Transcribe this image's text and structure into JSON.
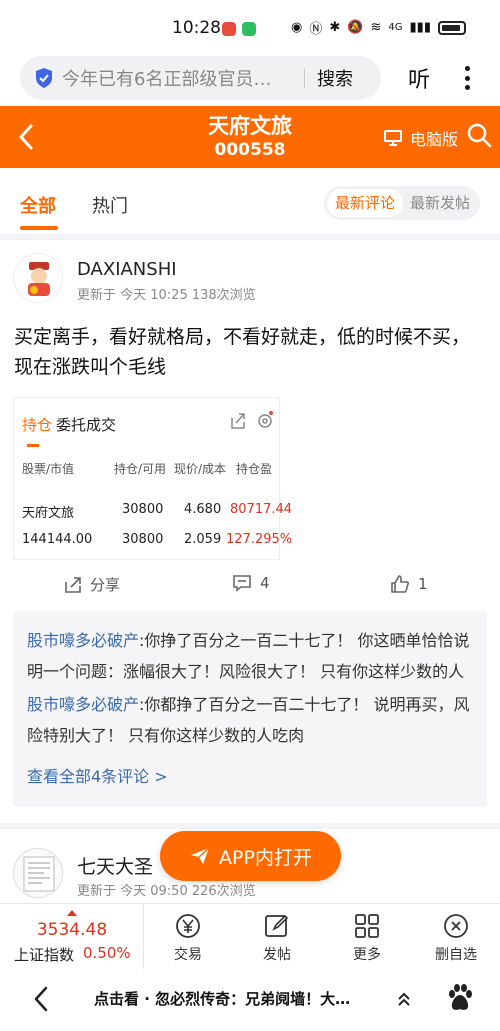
{
  "status_bar": {
    "time": "10:28",
    "network": "4G",
    "battery_level": 0.75
  },
  "browser": {
    "url_text": "今年已有6名正部级官员…",
    "search_label": "搜索",
    "listen_label": "听"
  },
  "header": {
    "stock_name": "天府文旅",
    "stock_code": "000558",
    "pc_view_label": "电脑版"
  },
  "tabs": {
    "all": "全部",
    "hot": "热门"
  },
  "sort": {
    "latest_comment": "最新评论",
    "latest_post": "最新发帖"
  },
  "post": {
    "author": "DAXIANSHI",
    "meta": "更新于 今天 10:25   138次浏览",
    "text": "买定离手，看好就格局，不看好就走，低的时候不买，现在涨跌叫个毛线",
    "embed": {
      "tab_position": "持仓",
      "tab_orders": "委托成交",
      "headers": [
        "股票/市值",
        "持仓/可用",
        "现价/成本",
        "持仓盈"
      ],
      "row1": {
        "name": "天府文旅",
        "holding": "30800",
        "price": "4.680",
        "pnl": "80717.44"
      },
      "row2": {
        "name": "144144.00",
        "holding": "30800",
        "price": "2.059",
        "pnl": "127.295%"
      }
    },
    "share_label": "分享",
    "comment_count": "4",
    "like_count": "1"
  },
  "comments": [
    {
      "user": "股市嚎多必破产",
      "text": ":你挣了百分之一百二十七了！ 你这晒单恰恰说明一个问题：涨幅很大了！风险很大了！ 只有你这样少数的人吃肉"
    },
    {
      "user": "股市嚎多必破产",
      "text": ":你都挣了百分之一百二十七了！ 说明再买，风险特别大了！ 只有你这样少数的人吃肉"
    }
  ],
  "view_all_comments": "查看全部4条评论 >",
  "post2": {
    "author": "七天大圣",
    "meta": "更新于 今天 09:50   226次浏览"
  },
  "app_open_label": "APP内打开",
  "bottom_bar": {
    "index_value": "3534.48",
    "index_name": "上证指数",
    "index_pct": "0.50%",
    "trade": "交易",
    "post": "发帖",
    "more": "更多",
    "remove_watch": "删自选"
  },
  "system_bar": {
    "news": "点击看 · 忽必烈传奇：兄弟阋墙！大…"
  },
  "colors": {
    "brand_orange": "#ff6a00",
    "up_red": "#e0301e",
    "link_blue": "#3b6aa8"
  }
}
